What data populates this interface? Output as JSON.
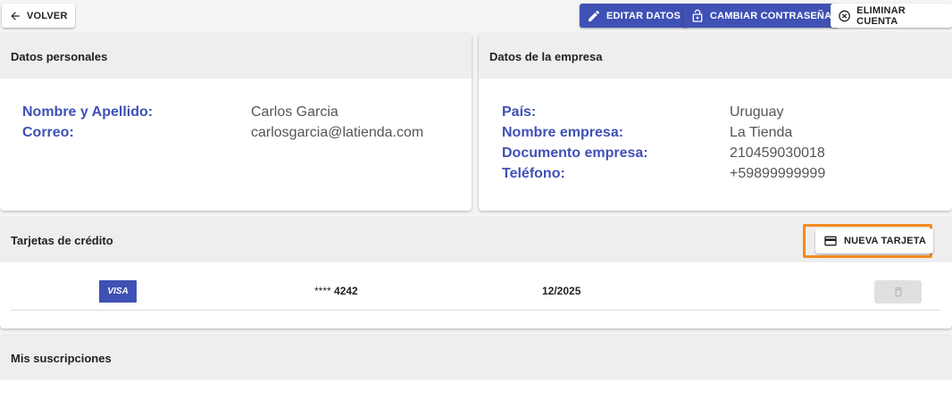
{
  "toolbar": {
    "back_label": "VOLVER",
    "edit_label": "EDITAR DATOS",
    "change_password_label": "CAMBIAR CONTRASEÑA",
    "delete_account_label": "ELIMINAR CUENTA"
  },
  "personal": {
    "title": "Datos personales",
    "fields": [
      {
        "label": "Nombre y Apellido:",
        "value": "Carlos Garcia"
      },
      {
        "label": "Correo:",
        "value": "carlosgarcia@latienda.com"
      }
    ]
  },
  "company": {
    "title": "Datos de la empresa",
    "fields": [
      {
        "label": "País:",
        "value": "Uruguay"
      },
      {
        "label": "Nombre empresa:",
        "value": "La Tienda"
      },
      {
        "label": "Documento empresa:",
        "value": "210459030018"
      },
      {
        "label": "Teléfono:",
        "value": "+59899999999"
      }
    ]
  },
  "cards": {
    "title": "Tarjetas de crédito",
    "new_card_label": "NUEVA TARJETA",
    "items": [
      {
        "brand": "VISA",
        "masked_prefix": "****",
        "last4": "4242",
        "expiry": "12/2025"
      }
    ]
  },
  "subscriptions": {
    "title": "Mis suscripciones"
  },
  "colors": {
    "accent": "#3f51b5",
    "highlight": "#f58a1f"
  }
}
